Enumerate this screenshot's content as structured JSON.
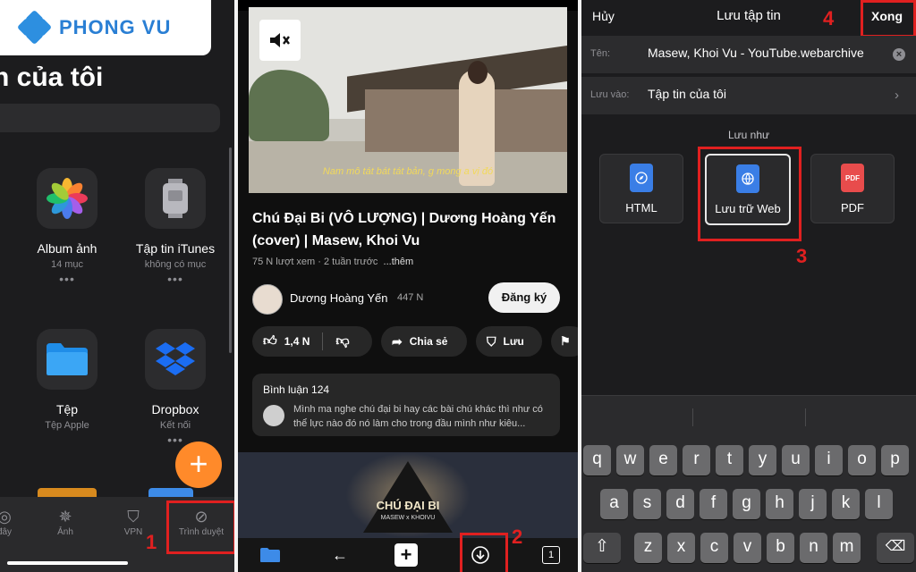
{
  "brand": {
    "name": "PHONG VU"
  },
  "panel1": {
    "title": "n của tôi",
    "apps": [
      {
        "name": "Album ảnh",
        "sub": "14 mục",
        "icon": "photos-icon"
      },
      {
        "name": "Tập tin iTunes",
        "sub": "không có mục",
        "icon": "ipod-icon"
      },
      {
        "name": "Tệp",
        "sub": "Tệp Apple",
        "icon": "folder-icon"
      },
      {
        "name": "Dropbox",
        "sub": "Kết nối",
        "icon": "dropbox-icon"
      }
    ],
    "dots": "•••",
    "fab": "+",
    "tabs": [
      "đây",
      "Ảnh",
      "VPN",
      "Trình duyệt"
    ],
    "step": "1"
  },
  "panel2": {
    "subtitle": "Nam mô tát bát tát bản, g mong a vị đó",
    "video_title": "Chú Đại Bi (VÔ LƯỢNG) | Dương Hoàng Yến (cover) | Masew, Khoi Vu",
    "views": "75 N lượt xem · 2 tuần trước",
    "more": "...thêm",
    "channel": "Dương Hoàng Yến",
    "channel_subs": "447 N",
    "subscribe": "Đăng ký",
    "likes": "1,4 N",
    "share": "Chia sẻ",
    "save": "Lưu",
    "comments_title": "Bình luận 124",
    "comment_text": "Mình ma nghe chú đại bi hay các bài chú khác thì như có thể lực nào đó nó làm cho trong đầu mình như kiêu...",
    "thumb_title": "CHÚ ĐẠI BI",
    "thumb_sub": "MASEW x KHOIVU",
    "tab_count": "1",
    "step": "2"
  },
  "panel3": {
    "cancel": "Hủy",
    "title": "Lưu tập tin",
    "done": "Xong",
    "name_label": "Tên:",
    "name_value": "Masew, Khoi Vu - YouTube.webarchive",
    "save_to_label": "Lưu vào:",
    "save_to_value": "Tập tin của tôi",
    "save_as_label": "Lưu như",
    "options": [
      {
        "name": "HTML",
        "color": "#3a7ee6"
      },
      {
        "name": "Lưu trữ Web",
        "color": "#3a7ee6"
      },
      {
        "name": "PDF",
        "color": "#e84c4c",
        "badge": "PDF"
      }
    ],
    "keys_row1": [
      "q",
      "w",
      "e",
      "r",
      "t",
      "y",
      "u",
      "i",
      "o",
      "p"
    ],
    "keys_row2": [
      "a",
      "s",
      "d",
      "f",
      "g",
      "h",
      "j",
      "k",
      "l"
    ],
    "keys_row3": [
      "z",
      "x",
      "c",
      "v",
      "b",
      "n",
      "m"
    ],
    "step3": "3",
    "step4": "4"
  },
  "colors": {
    "annotation_red": "#e02020",
    "fab_orange": "#ff8a2a",
    "brand_blue": "#2a7fd4"
  }
}
